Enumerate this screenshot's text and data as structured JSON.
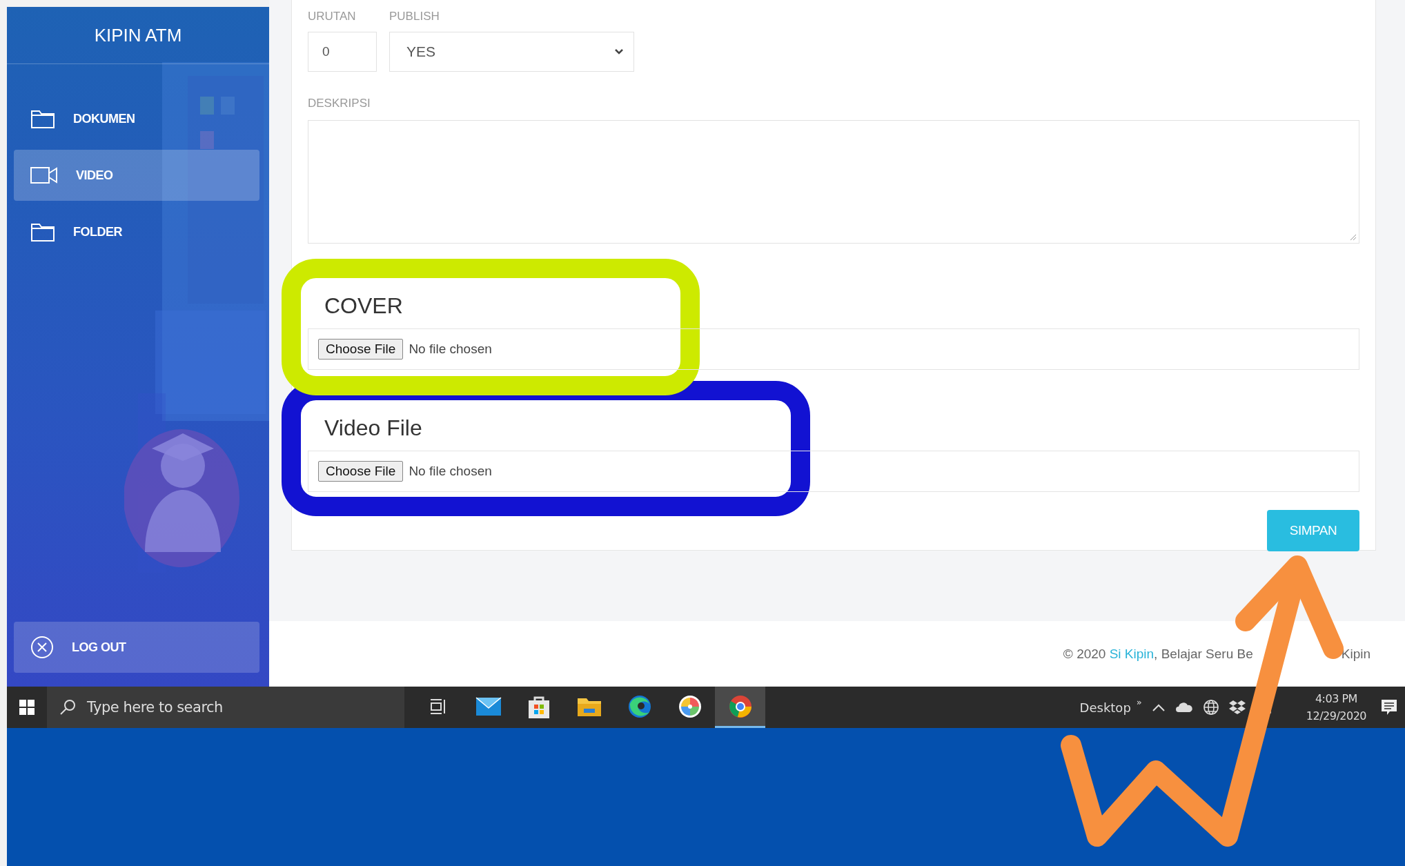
{
  "sidebar": {
    "title": "KIPIN ATM",
    "items": [
      {
        "kind": "folder",
        "label": "DOKUMEN",
        "selected": false
      },
      {
        "kind": "video",
        "label": "VIDEO",
        "selected": true
      },
      {
        "kind": "folder",
        "label": "FOLDER",
        "selected": false
      }
    ],
    "logout": "LOG OUT"
  },
  "form": {
    "urutan": {
      "label": "URUTAN",
      "value": "0"
    },
    "publish": {
      "label": "PUBLISH",
      "value": "YES"
    },
    "deskripsi": {
      "label": "DESKRIPSI"
    },
    "uploads": [
      {
        "heading": "COVER",
        "button": "Choose File",
        "status": "No file chosen",
        "highlight": {
          "color": "#cdea00"
        }
      },
      {
        "heading": "Video File",
        "button": "Choose File",
        "status": "No file chosen",
        "highlight": {
          "color": "#1212d2"
        }
      }
    ],
    "submit": "SIMPAN"
  },
  "footer": {
    "prefix": "© 2020 ",
    "link": "Si Kipin",
    "text": ", Belajar Seru Be",
    "tail": "Kipin"
  },
  "annotation_arrow": {
    "color": "#f7903f"
  },
  "taskbar": {
    "search_placeholder": "Type here to search",
    "apps": [
      {
        "kind": "task-view",
        "selected": false
      },
      {
        "kind": "mail",
        "selected": false
      },
      {
        "kind": "store",
        "selected": false
      },
      {
        "kind": "explorer",
        "selected": false
      },
      {
        "kind": "edge",
        "selected": false
      },
      {
        "kind": "color-wheel",
        "selected": false
      },
      {
        "kind": "chrome",
        "selected": true
      }
    ],
    "desktop": "Desktop",
    "more": "»",
    "time": "4:03 PM",
    "date": "12/29/2020"
  }
}
